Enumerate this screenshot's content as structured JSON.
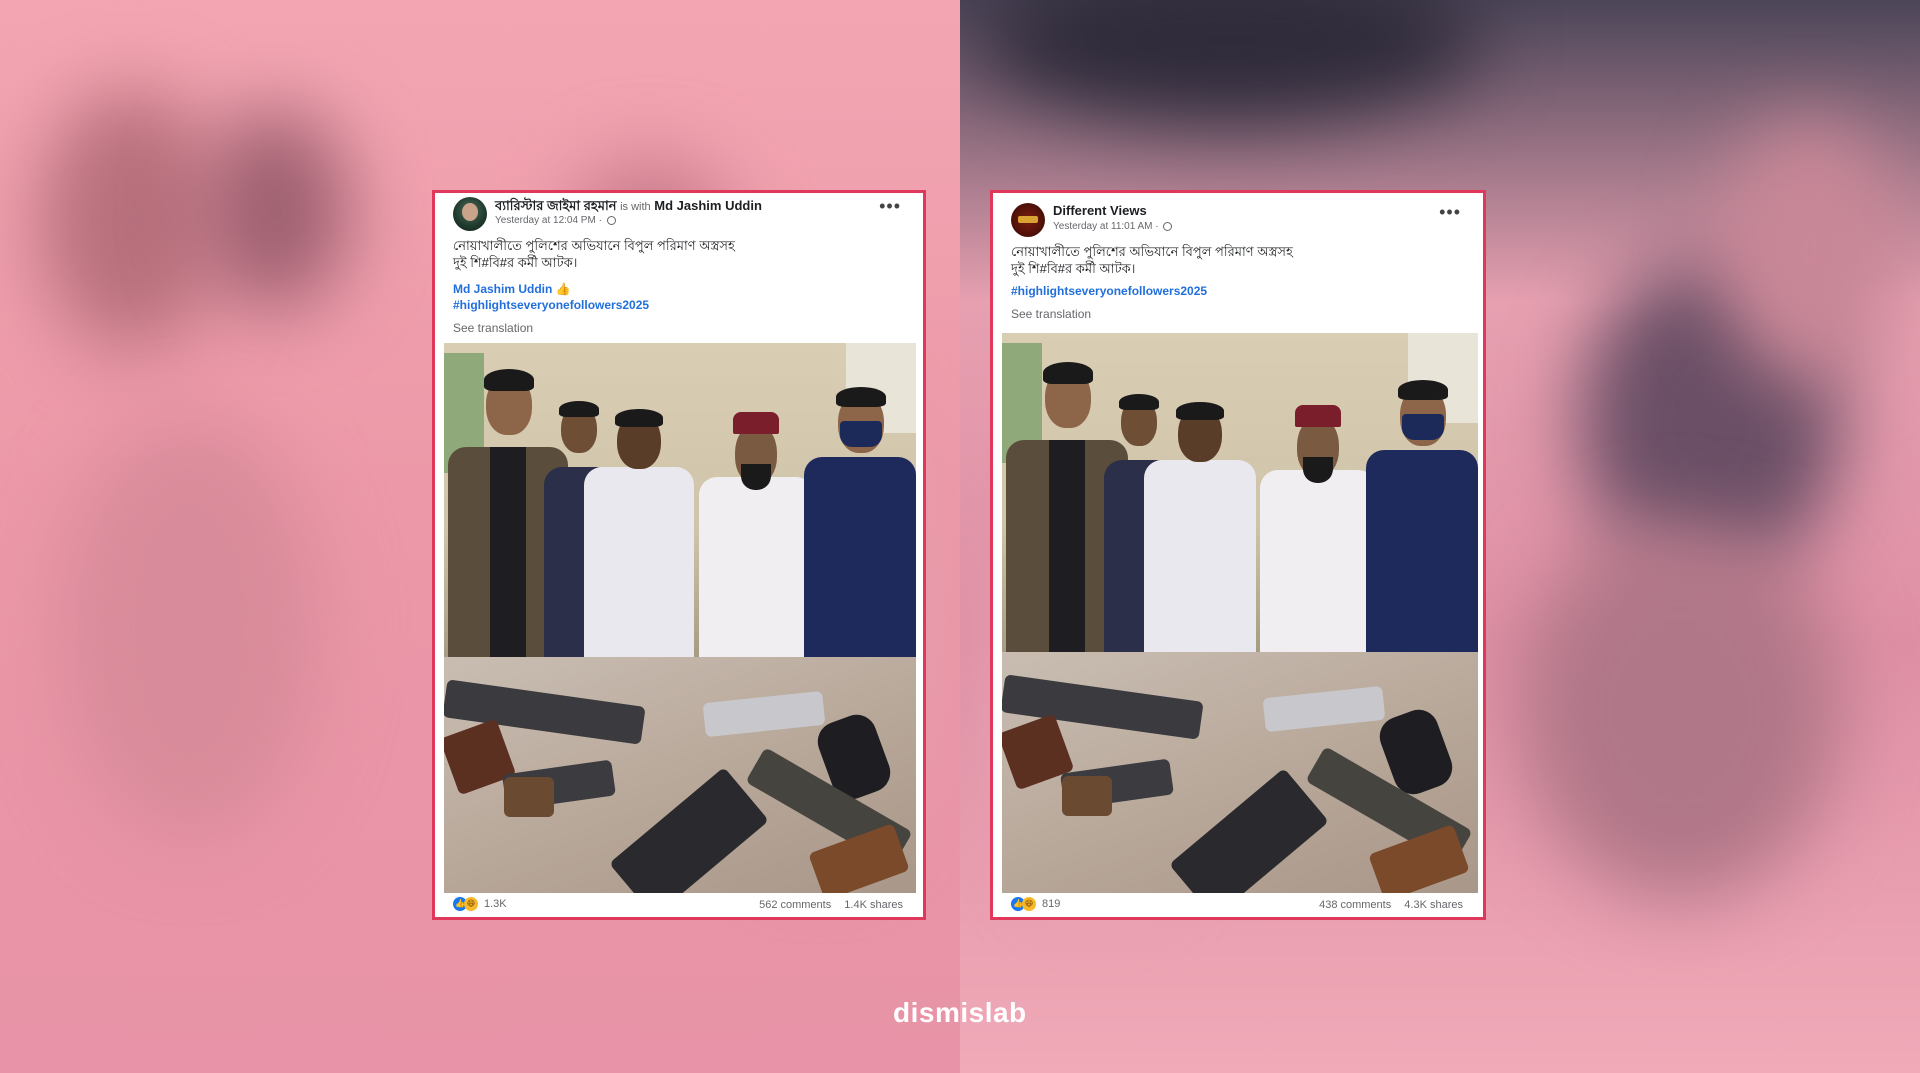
{
  "logo": "dismislab",
  "left_post": {
    "author": "ব্যারিস্টার জাইমা রহমান",
    "with_text": "is with",
    "tagged_user": "Md Jashim Uddin",
    "time": "Yesterday at 12:04 PM ·",
    "text_line1": "নোয়াখালীতে পুলিশের অভিযানে বিপুল পরিমাণ অস্ত্রসহ",
    "text_line2": "দুই শি#বি#র কর্মী আটক।",
    "mention": "Md Jashim Uddin 👍",
    "hashtag": "#highlightseveryonefollowers2025",
    "see_translation": "See translation",
    "reaction_count": "1.3K",
    "comments": "562 comments",
    "shares": "1.4K shares"
  },
  "right_post": {
    "author": "Different Views",
    "time": "Yesterday at 11:01 AM ·",
    "text_line1": "নোয়াখালীতে পুলিশের অভিযানে বিপুল পরিমাণ অস্ত্রসহ",
    "text_line2": "দুই শি#বি#র কর্মী আটক।",
    "hashtag": "#highlightseveryonefollowers2025",
    "see_translation": "See translation",
    "reaction_count": "819",
    "comments": "438 comments",
    "shares": "4.3K shares"
  },
  "icons": {
    "more": "more-options-icon",
    "audience": "globe-icon",
    "like": "like-reaction-icon",
    "haha": "haha-reaction-icon"
  },
  "colors": {
    "card_border": "#e0385a",
    "link": "#216fdb",
    "like": "#1877f2",
    "haha": "#f7b928"
  }
}
